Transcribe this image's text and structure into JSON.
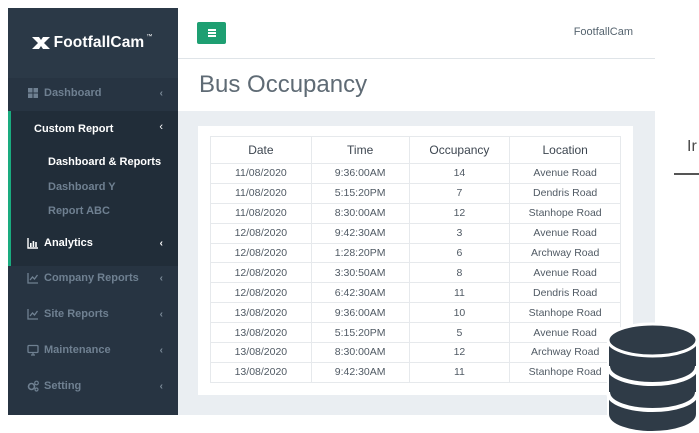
{
  "sidebar": {
    "brand": "FootfallCam",
    "brand_tm": "™",
    "items": [
      {
        "label": "Dashboard",
        "icon": "grid-icon"
      },
      {
        "label": "Custom Report",
        "icon": ""
      },
      {
        "label": "Dashboard & Reports",
        "icon": ""
      },
      {
        "label": "Dashboard Y",
        "icon": ""
      },
      {
        "label": "Report ABC",
        "icon": ""
      },
      {
        "label": "Analytics",
        "icon": "bar-chart-icon"
      },
      {
        "label": "Company Reports",
        "icon": "line-chart-icon"
      },
      {
        "label": "Site Reports",
        "icon": "line-chart-icon"
      },
      {
        "label": "Maintenance",
        "icon": "monitor-icon"
      },
      {
        "label": "Setting",
        "icon": "gears-icon"
      }
    ]
  },
  "topbar": {
    "brand_right": "FootfallCam",
    "menu_icon": "hamburger-icon"
  },
  "page": {
    "title": "Bus Occupancy"
  },
  "table": {
    "headers": [
      "Date",
      "Time",
      "Occupancy",
      "Location"
    ],
    "rows": [
      [
        "11/08/2020",
        "9:36:00AM",
        "14",
        "Avenue Road"
      ],
      [
        "11/08/2020",
        "5:15:20PM",
        "7",
        "Dendris Road"
      ],
      [
        "11/08/2020",
        "8:30:00AM",
        "12",
        "Stanhope Road"
      ],
      [
        "12/08/2020",
        "9:42:30AM",
        "3",
        "Avenue Road"
      ],
      [
        "12/08/2020",
        "1:28:20PM",
        "6",
        "Archway Road"
      ],
      [
        "12/08/2020",
        "3:30:50AM",
        "8",
        "Avenue Road"
      ],
      [
        "12/08/2020",
        "6:42:30AM",
        "11",
        "Dendris Road"
      ],
      [
        "13/08/2020",
        "9:36:00AM",
        "10",
        "Stanhope Road"
      ],
      [
        "13/08/2020",
        "5:15:20PM",
        "5",
        "Avenue Road"
      ],
      [
        "13/08/2020",
        "8:30:00AM",
        "12",
        "Archway Road"
      ],
      [
        "13/08/2020",
        "9:42:30AM",
        "11",
        "Stanhope Road"
      ]
    ]
  },
  "overlay": {
    "edge_text": "Ir",
    "icon": "database-icon"
  },
  "colors": {
    "sidebar": "#273442",
    "accent": "#1aab7f",
    "button": "#1e9f72",
    "content_bg": "#eaeef2"
  }
}
